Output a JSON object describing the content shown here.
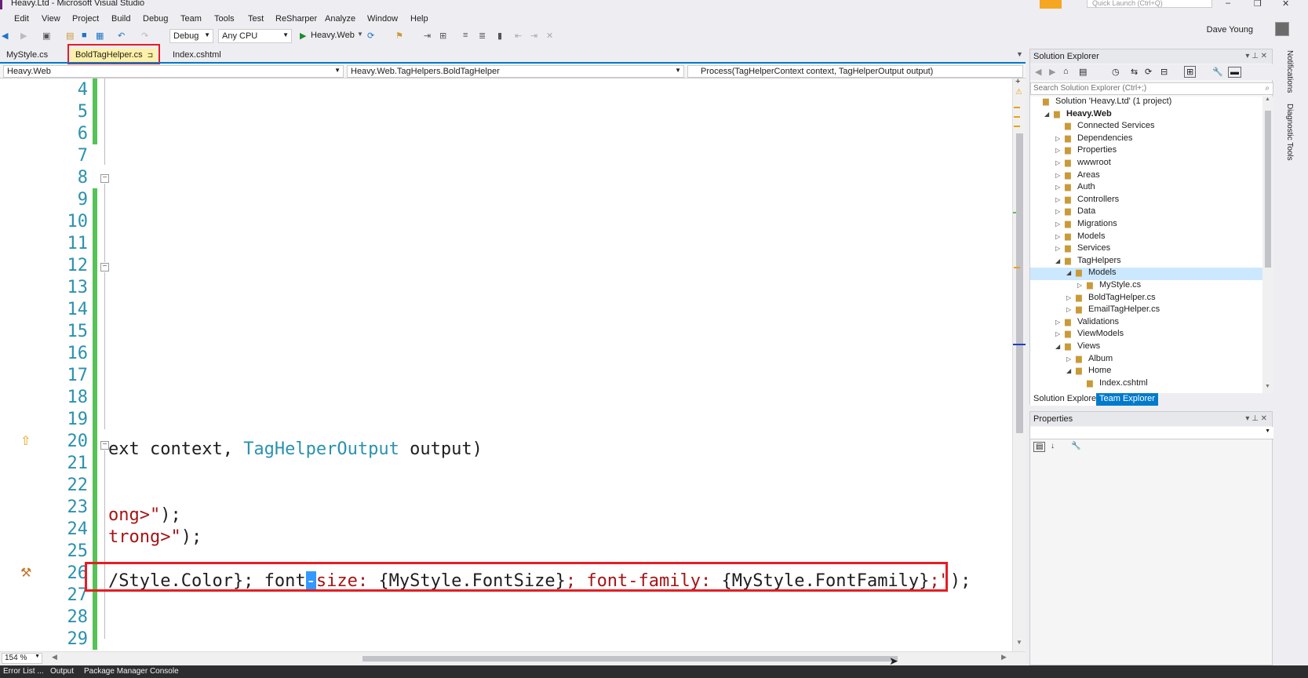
{
  "window": {
    "title": "Heavy.Ltd - Microsoft Visual Studio",
    "quick_launch_placeholder": "Quick Launch (Ctrl+Q)",
    "user": "Dave Young"
  },
  "menu": [
    "Edit",
    "View",
    "Project",
    "Build",
    "Debug",
    "Team",
    "Tools",
    "Test",
    "ReSharper",
    "Analyze",
    "Window",
    "Help"
  ],
  "toolbar": {
    "config": "Debug",
    "platform": "Any CPU",
    "run_target": "Heavy.Web"
  },
  "tabs": [
    {
      "label": "MyStyle.cs",
      "active": false
    },
    {
      "label": "BoldTagHelper.cs",
      "active": true,
      "pin": "⊐"
    },
    {
      "label": "Index.cshtml",
      "active": false
    }
  ],
  "navbar": {
    "project": "Heavy.Web",
    "type": "Heavy.Web.TagHelpers.BoldTagHelper",
    "member": "Process(TagHelperContext context, TagHelperOutput output)"
  },
  "editor": {
    "line_numbers": [
      "4",
      "5",
      "6",
      "7",
      "8",
      "9",
      "10",
      "11",
      "12",
      "13",
      "14",
      "15",
      "16",
      "17",
      "18",
      "19",
      "20",
      "21",
      "22",
      "23",
      "24",
      "25",
      "26",
      "27",
      "28",
      "29"
    ],
    "line20": {
      "pre": "ext context, ",
      "type": "TagHelperOutput",
      "post": " output)"
    },
    "line23": {
      "str": "ong>\"",
      "post": ");"
    },
    "line24": {
      "str": "trong>\"",
      "post": ");"
    },
    "line26": {
      "s1": "/Style.Color}; font",
      "caret": "-",
      "s2": "size: ",
      "s3": "{MyStyle.FontSize}",
      "s4": "; font-family: ",
      "s5": "{MyStyle.FontFamily}",
      "s6": ";\"",
      "s7": ");"
    },
    "zoom": "154 %"
  },
  "bottom_tabs": [
    "Error List ...",
    "Output",
    "Package Manager Console"
  ],
  "solution_explorer": {
    "title": "Solution Explorer",
    "search_placeholder": "Search Solution Explorer (Ctrl+;)",
    "nodes": [
      {
        "label": "Solution 'Heavy.Ltd' (1 project)",
        "depth": 0,
        "exp": ""
      },
      {
        "label": "Heavy.Web",
        "depth": 1,
        "exp": "◢",
        "bold": true
      },
      {
        "label": "Connected Services",
        "depth": 2,
        "exp": ""
      },
      {
        "label": "Dependencies",
        "depth": 2,
        "exp": "▷"
      },
      {
        "label": "Properties",
        "depth": 2,
        "exp": "▷"
      },
      {
        "label": "wwwroot",
        "depth": 2,
        "exp": "▷"
      },
      {
        "label": "Areas",
        "depth": 2,
        "exp": "▷"
      },
      {
        "label": "Auth",
        "depth": 2,
        "exp": "▷"
      },
      {
        "label": "Controllers",
        "depth": 2,
        "exp": "▷"
      },
      {
        "label": "Data",
        "depth": 2,
        "exp": "▷"
      },
      {
        "label": "Migrations",
        "depth": 2,
        "exp": "▷"
      },
      {
        "label": "Models",
        "depth": 2,
        "exp": "▷"
      },
      {
        "label": "Services",
        "depth": 2,
        "exp": "▷"
      },
      {
        "label": "TagHelpers",
        "depth": 2,
        "exp": "◢"
      },
      {
        "label": "Models",
        "depth": 3,
        "exp": "◢",
        "selected": true
      },
      {
        "label": "MyStyle.cs",
        "depth": 4,
        "exp": "▷"
      },
      {
        "label": "BoldTagHelper.cs",
        "depth": 3,
        "exp": "▷"
      },
      {
        "label": "EmailTagHelper.cs",
        "depth": 3,
        "exp": "▷"
      },
      {
        "label": "Validations",
        "depth": 2,
        "exp": "▷"
      },
      {
        "label": "ViewModels",
        "depth": 2,
        "exp": "▷"
      },
      {
        "label": "Views",
        "depth": 2,
        "exp": "◢"
      },
      {
        "label": "Album",
        "depth": 3,
        "exp": "▷"
      },
      {
        "label": "Home",
        "depth": 3,
        "exp": "◢"
      },
      {
        "label": "Index.cshtml",
        "depth": 4,
        "exp": ""
      }
    ],
    "tabs": [
      "Solution Explorer",
      "Team Explorer"
    ]
  },
  "properties": {
    "title": "Properties"
  },
  "side_tabs": [
    "Notifications",
    "Diagnostic Tools"
  ]
}
